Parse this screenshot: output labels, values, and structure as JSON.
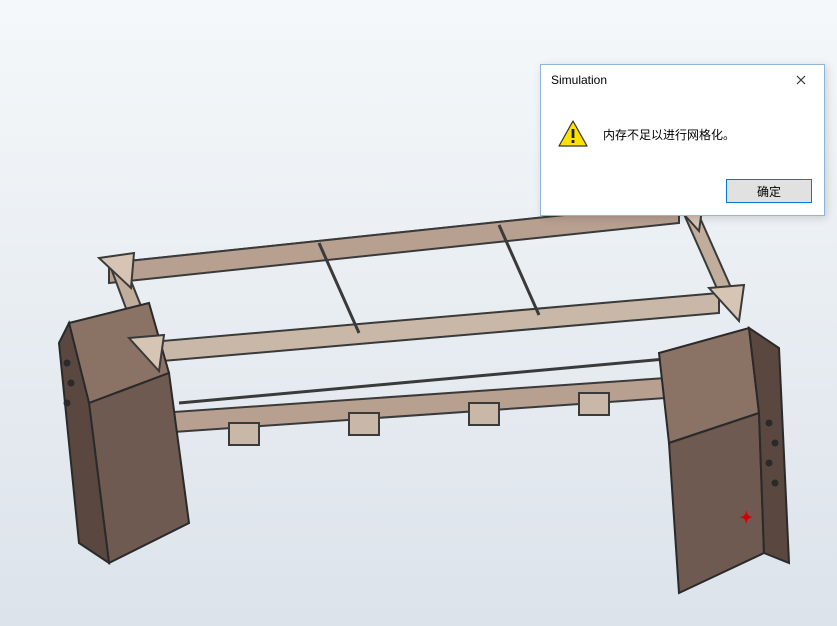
{
  "dialog": {
    "title": "Simulation",
    "message": "内存不足以进行网格化。",
    "ok_label": "确定"
  },
  "icons": {
    "warning": "warning-triangle",
    "close": "close-x"
  },
  "viewport": {
    "model_description": "3D steel frame structure (bench/table frame)",
    "background_gradient_top": "#f5f8fa",
    "background_gradient_bottom": "#dce3ea"
  }
}
